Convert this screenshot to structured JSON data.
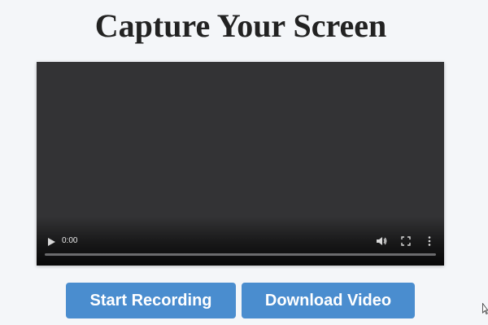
{
  "page": {
    "title": "Capture Your Screen"
  },
  "video": {
    "current_time": "0:00",
    "progress": 0,
    "icons": [
      "play-icon",
      "volume-icon",
      "fullscreen-icon",
      "more-options-icon"
    ]
  },
  "actions": {
    "start_label": "Start Recording",
    "download_label": "Download Video"
  },
  "colors": {
    "background": "#f4f6f9",
    "title": "#222222",
    "video_surface": "#333335",
    "button": "#4a8dcf",
    "button_text": "#ffffff"
  }
}
